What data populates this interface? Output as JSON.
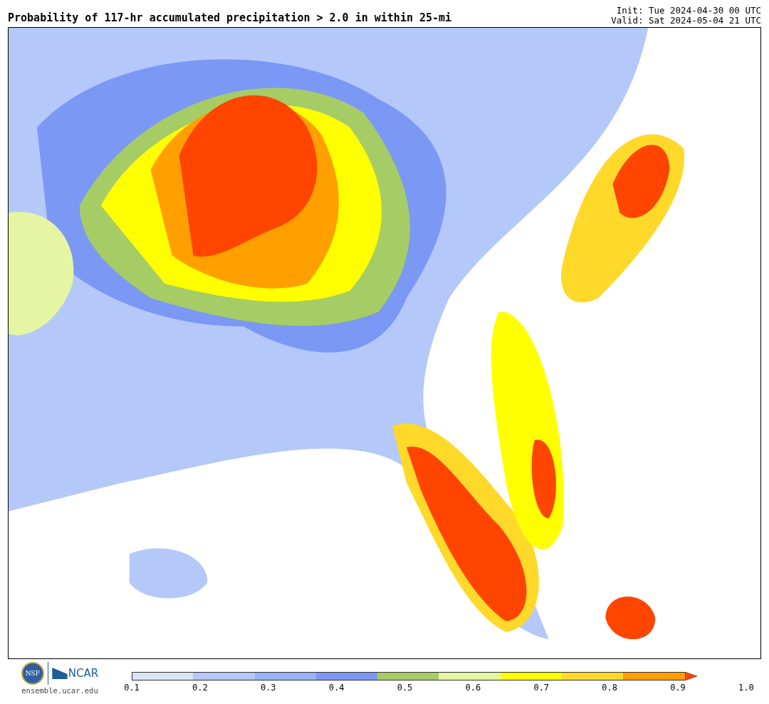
{
  "header": {
    "title": "Probability of 117-hr accumulated precipitation > 2.0 in within 25-mi",
    "init": "Init: Tue 2024-04-30 00 UTC",
    "valid": "Valid: Sat 2024-05-04 21 UTC"
  },
  "footer": {
    "logo_left": "NSF",
    "logo_right": "NCAR",
    "url": "ensemble.ucar.edu"
  },
  "colorbar": {
    "segments": [
      {
        "kind": "bin",
        "color": "#dbe5f1"
      },
      {
        "kind": "bin",
        "color": "#b4c8fa"
      },
      {
        "kind": "bin",
        "color": "#97b2f9"
      },
      {
        "kind": "bin",
        "color": "#7b98f5"
      },
      {
        "kind": "bin",
        "color": "#a6cc66"
      },
      {
        "kind": "bin",
        "color": "#e6f5a3"
      },
      {
        "kind": "bin",
        "color": "#ffff00"
      },
      {
        "kind": "bin",
        "color": "#ffd92a"
      },
      {
        "kind": "bin",
        "color": "#ff9f00"
      },
      {
        "kind": "over",
        "color": "#ff4500"
      }
    ],
    "ticks": [
      "0.1",
      "0.2",
      "0.3",
      "0.4",
      "0.5",
      "0.6",
      "0.7",
      "0.8",
      "0.9",
      "1.0"
    ]
  }
}
